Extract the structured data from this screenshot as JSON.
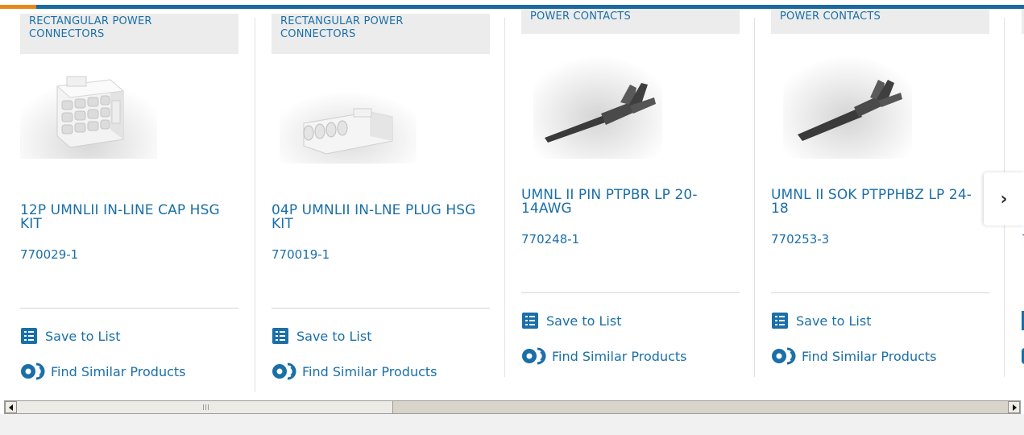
{
  "cards": [
    {
      "category": "RECTANGULAR POWER CONNECTORS",
      "title": "12P UMNLII IN-LINE CAP HSG KIT",
      "part_number": "770029-1",
      "save_label": "Save to List",
      "similar_label": "Find Similar Products",
      "image": "white-12-position-cap-housing"
    },
    {
      "category": "RECTANGULAR POWER CONNECTORS",
      "title": "04P UMNLII IN-LNE PLUG HSG KIT",
      "part_number": "770019-1",
      "save_label": "Save to List",
      "similar_label": "Find Similar Products",
      "image": "white-4-position-plug-housing"
    },
    {
      "category": "POWER CONTACTS",
      "title": "UMNL II PIN PTPBR LP 20-14AWG",
      "part_number": "770248-1",
      "save_label": "Save to List",
      "similar_label": "Find Similar Products",
      "image": "pin-contact"
    },
    {
      "category": "POWER CONTACTS",
      "title": "UMNL II SOK PTPPHBZ LP 24-18",
      "part_number": "770253-3",
      "save_label": "Save to List",
      "similar_label": "Find Similar Products",
      "image": "socket-contact"
    }
  ],
  "partial_card": {
    "part_number_fragment": "7"
  },
  "next_button": {
    "icon": "chevron-right-icon",
    "glyph": "›"
  },
  "colors": {
    "brand_blue": "#1a6fa8",
    "accent_orange": "#e8881a"
  }
}
